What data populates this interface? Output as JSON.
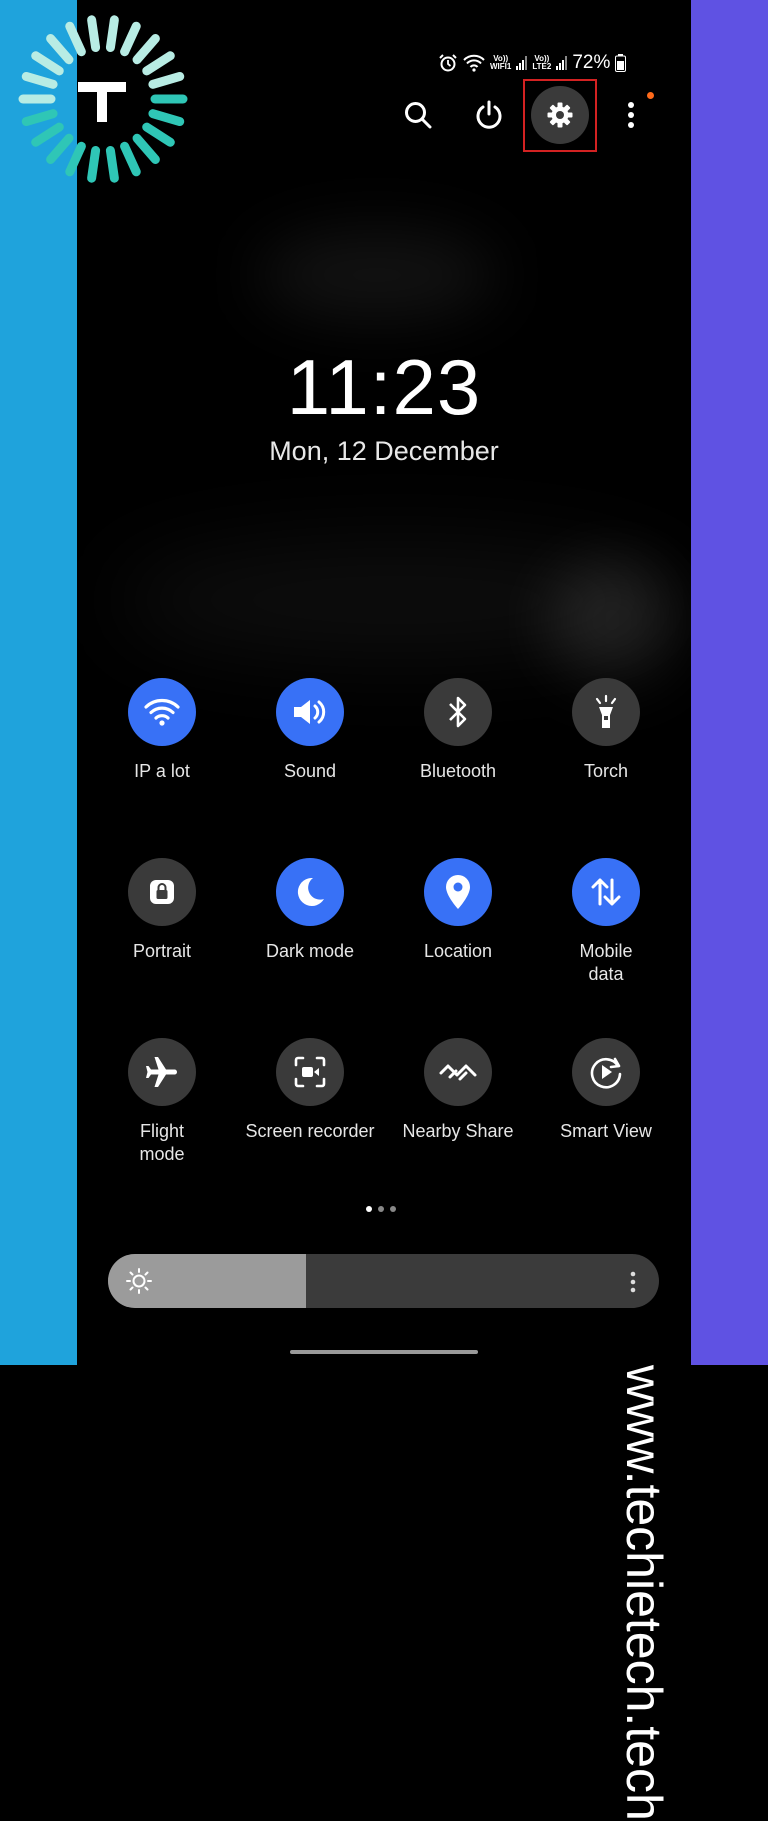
{
  "status_bar": {
    "wifi_tag_top": "Vo))",
    "wifi_tag_bottom": "WIFI1",
    "lte_tag_top": "Vo))",
    "lte_tag_bottom": "LTE2",
    "battery": "72%"
  },
  "top_actions": [
    "search-icon",
    "power-icon",
    "gear-icon",
    "more-vert-icon"
  ],
  "clock": {
    "time": "11:23",
    "date": "Mon, 12 December"
  },
  "tiles": [
    {
      "label": "IP a lot",
      "on": true,
      "icon": "wifi-icon"
    },
    {
      "label": "Sound",
      "on": true,
      "icon": "speaker-icon"
    },
    {
      "label": "Bluetooth",
      "on": false,
      "icon": "bluetooth-icon"
    },
    {
      "label": "Torch",
      "on": false,
      "icon": "flashlight-icon"
    },
    {
      "label": "Portrait",
      "on": false,
      "icon": "rotation-lock-icon"
    },
    {
      "label": "Dark mode",
      "on": true,
      "icon": "moon-icon"
    },
    {
      "label": "Location",
      "on": true,
      "icon": "location-pin-icon"
    },
    {
      "label": "Mobile data",
      "on": true,
      "icon": "data-arrows-icon"
    },
    {
      "label": "Flight mode",
      "on": false,
      "icon": "airplane-icon"
    },
    {
      "label": "Screen recorder",
      "on": false,
      "icon": "screen-record-icon"
    },
    {
      "label": "Nearby Share",
      "on": false,
      "icon": "nearby-share-icon"
    },
    {
      "label": "Smart View",
      "on": false,
      "icon": "smart-view-icon"
    }
  ],
  "pager": {
    "pages": 3,
    "current": 1
  },
  "brightness": {
    "level": 0.36
  },
  "watermark": "www.techietech.tech",
  "colors": {
    "accent": "#3871f6",
    "tile_off": "#3a3a3a",
    "highlight": "#d32222",
    "left_band": "#1fa3dc",
    "right_band": "#5f52e3"
  }
}
